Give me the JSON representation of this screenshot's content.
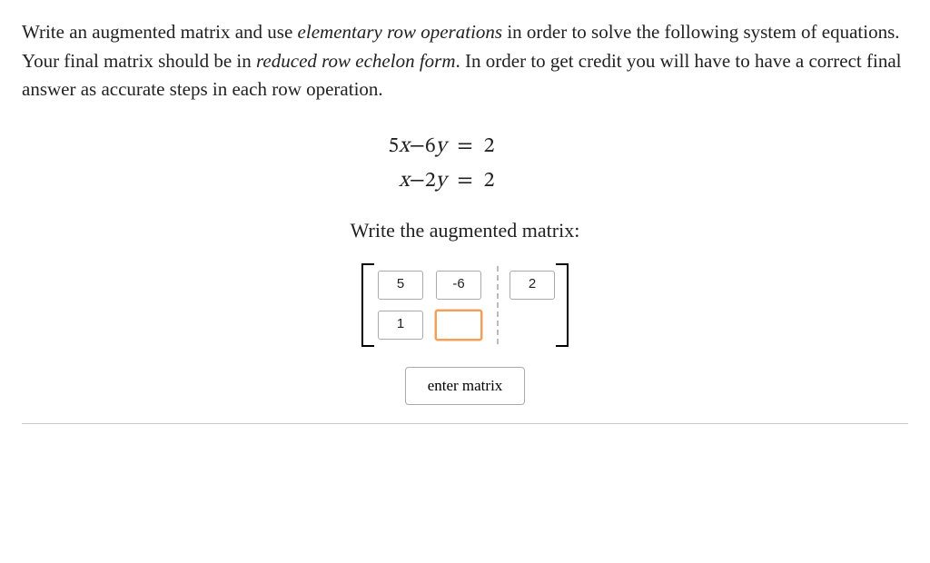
{
  "instructions": {
    "part1": "Write an augmented matrix and use ",
    "em1": "elementary row operations",
    "part2": " in order to solve the following system of equations. Your final matrix should be in ",
    "em2": "reduced row echelon form",
    "part3": ". In order to get credit you will have to have a correct final answer as accurate steps in each row operation."
  },
  "equations": {
    "row1": {
      "left_coeff": "5",
      "left_var": "x",
      "op": "−",
      "right_coeff": "6",
      "right_var": "y",
      "rhs": "2"
    },
    "row2": {
      "left_coeff": "",
      "left_var": "x",
      "op": "−",
      "right_coeff": "2",
      "right_var": "y",
      "rhs": "2"
    }
  },
  "sub_prompt": "Write the augmented matrix:",
  "matrix": {
    "r1c1": "5",
    "r1c2": "-6",
    "r1c3": "2",
    "r2c1": "1",
    "r2c2": "",
    "r2c3": ""
  },
  "button_label": "enter matrix"
}
